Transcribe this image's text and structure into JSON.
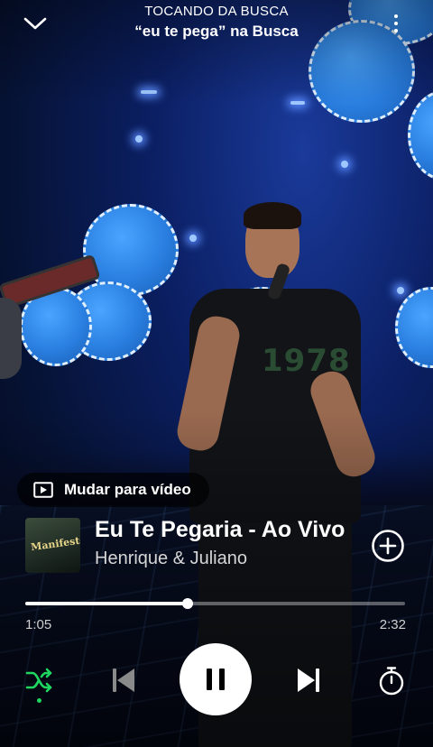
{
  "header": {
    "eyebrow": "TOCANDO DA BUSCA",
    "context_title": "“eu te pega” na Busca",
    "collapse_icon": "chevron-down-icon",
    "more_icon": "more-vertical-icon"
  },
  "video_toggle": {
    "label": "Mudar para vídeo",
    "icon": "video-play-icon"
  },
  "track": {
    "title": "Eu Te Pegaria - Ao Vivo",
    "artist": "Henrique & Juliano",
    "cover_text": "Manifesto",
    "add_icon": "add-circle-icon"
  },
  "playback": {
    "elapsed": "1:05",
    "total": "2:32",
    "progress_fraction": 0.428,
    "is_playing": true,
    "shuffle_on": true
  },
  "controls": {
    "shuffle_icon": "shuffle-icon",
    "previous_icon": "skip-previous-icon",
    "pause_icon": "pause-icon",
    "next_icon": "skip-next-icon",
    "timer_icon": "sleep-timer-icon"
  },
  "colors": {
    "accent": "#1ed760",
    "text": "#ffffff",
    "muted": "#d0d0d0",
    "disabled": "#8a8a8a"
  }
}
